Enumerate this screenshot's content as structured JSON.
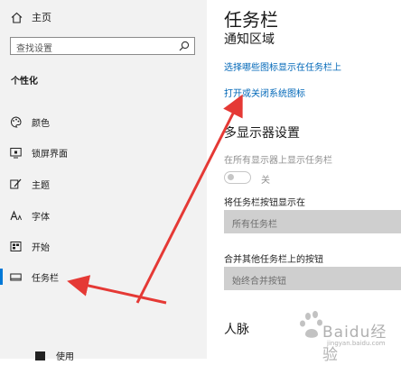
{
  "sidebar": {
    "home_label": "主页",
    "search_placeholder": "查找设置",
    "section_title": "个性化",
    "items": [
      {
        "label": "颜色",
        "icon": "palette-icon"
      },
      {
        "label": "锁屏界面",
        "icon": "lockscreen-icon"
      },
      {
        "label": "主题",
        "icon": "theme-brush-icon"
      },
      {
        "label": "字体",
        "icon": "font-icon"
      },
      {
        "label": "开始",
        "icon": "start-icon"
      },
      {
        "label": "任务栏",
        "icon": "taskbar-icon",
        "active": true
      }
    ],
    "partial_item_label": "使用"
  },
  "main": {
    "title": "任务栏",
    "notification_area": "通知区域",
    "link1": "选择哪些图标显示在任务栏上",
    "link2": "打开或关闭系统图标",
    "multi_display_head": "多显示器设置",
    "show_all_label": "在所有显示器上显示任务栏",
    "toggle_state": "关",
    "show_buttons_label": "将任务栏按钮显示在",
    "show_buttons_value": "所有任务栏",
    "combine_label": "合并其他任务栏上的按钮",
    "combine_value": "始终合并按钮",
    "people_head": "人脉"
  },
  "watermark": {
    "text": "Baidu经验",
    "sub": "jingyan.baidu.com"
  },
  "colors": {
    "accent": "#0078d7",
    "link": "#0067b8",
    "arrow": "#e53935",
    "sidebar_bg": "#f2f2f2"
  }
}
